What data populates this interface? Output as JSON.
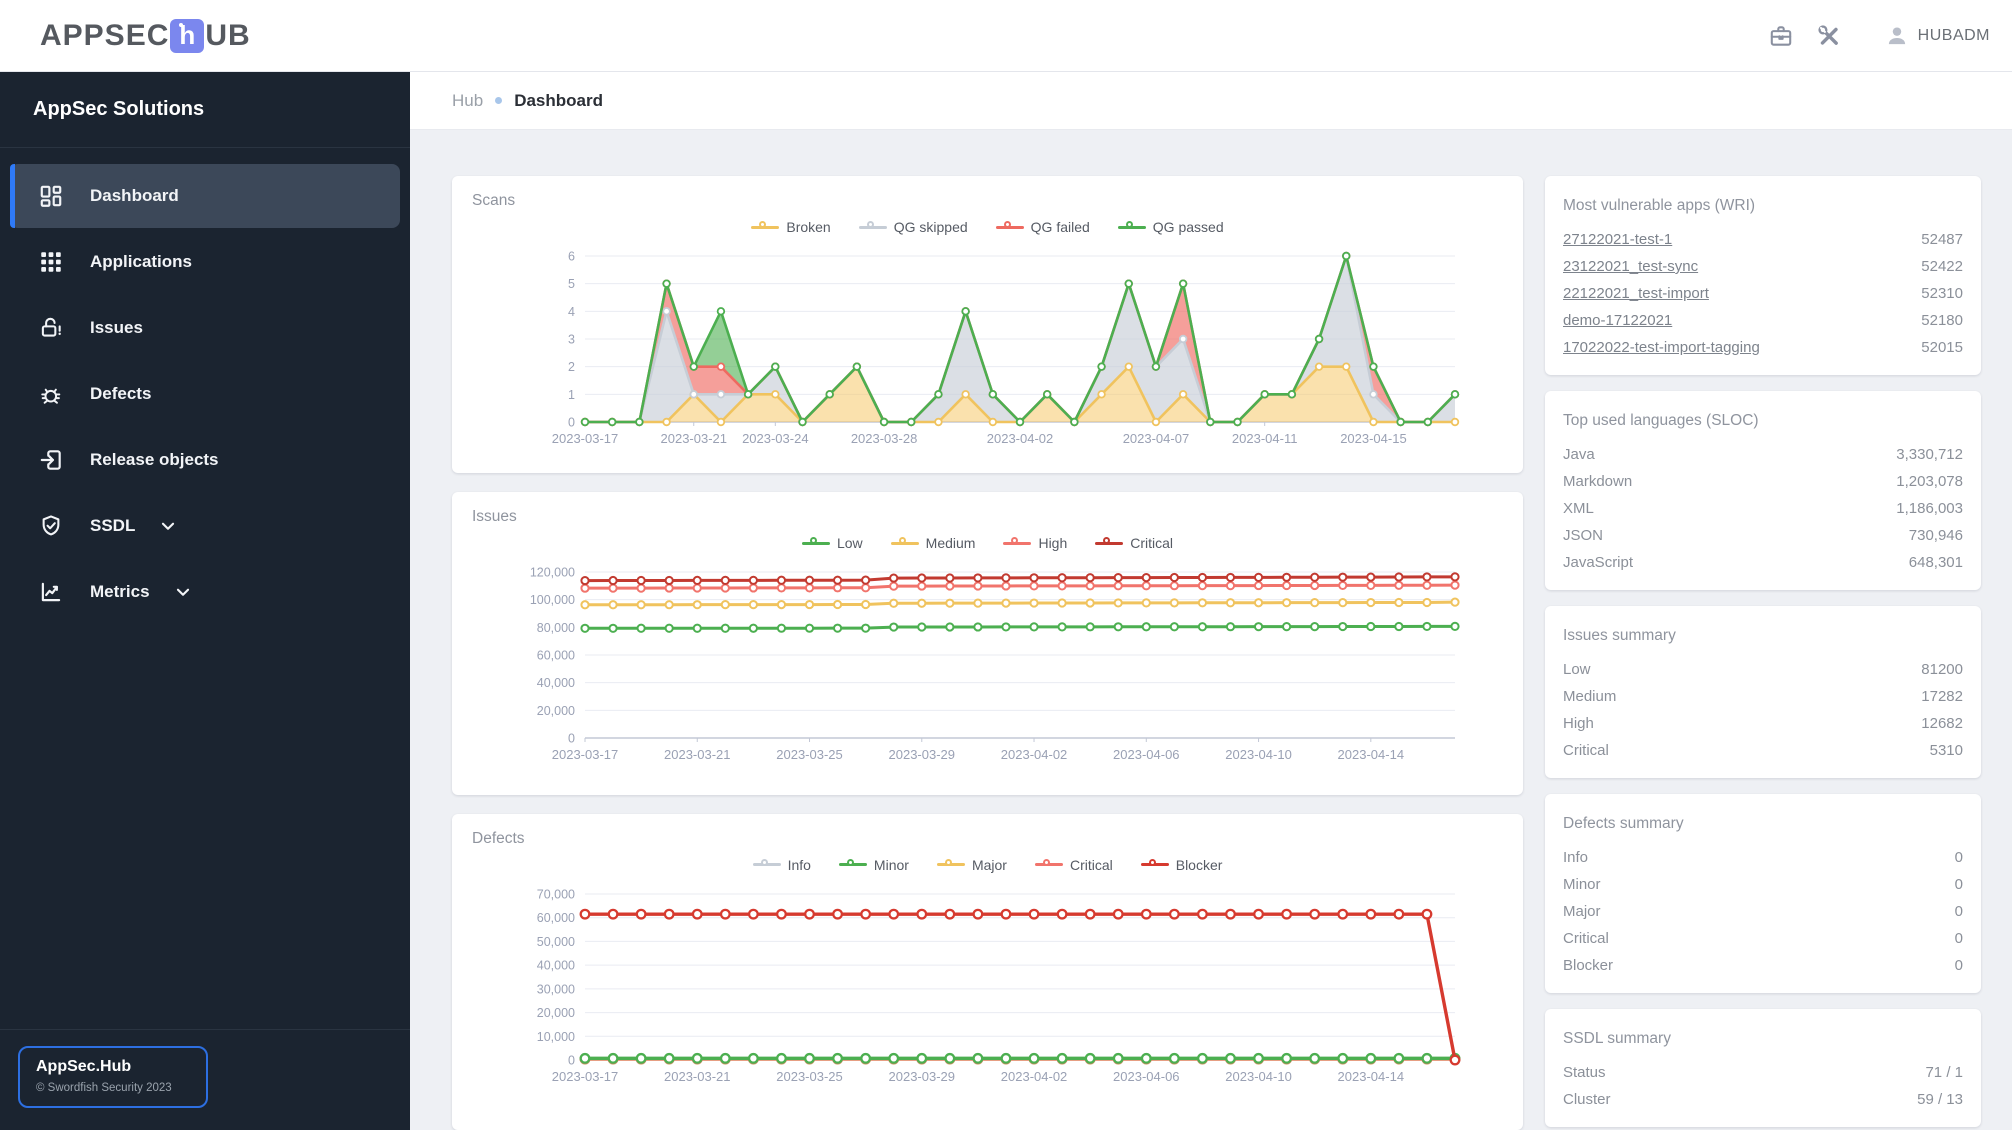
{
  "topbar": {
    "logo_pre": "APPSEC",
    "logo_mid": "h",
    "logo_post": "UB",
    "user_name": "HUBADM",
    "icons": [
      "briefcase-icon",
      "tools-icon",
      "person-icon"
    ]
  },
  "breadcrumb": {
    "root": "Hub",
    "current": "Dashboard"
  },
  "sidebar": {
    "title": "AppSec Solutions",
    "items": [
      {
        "label": "Dashboard",
        "icon": "dashboard",
        "active": true,
        "chevron": false
      },
      {
        "label": "Applications",
        "icon": "applications",
        "active": false,
        "chevron": false
      },
      {
        "label": "Issues",
        "icon": "lock-alert",
        "active": false,
        "chevron": false
      },
      {
        "label": "Defects",
        "icon": "bug",
        "active": false,
        "chevron": false
      },
      {
        "label": "Release objects",
        "icon": "exit-to-app",
        "active": false,
        "chevron": false
      },
      {
        "label": "SSDL",
        "icon": "shield-check",
        "active": false,
        "chevron": true
      },
      {
        "label": "Metrics",
        "icon": "chart-line",
        "active": false,
        "chevron": true
      }
    ],
    "footer_title": "AppSec.Hub",
    "footer_copyright": "© Swordfish Security 2023"
  },
  "chart_data": [
    {
      "type": "area",
      "stacked": true,
      "title": "Scans",
      "ylim": [
        0,
        6
      ],
      "y_step": 1,
      "y_comma": false,
      "line_width": 2.6,
      "marker_r": 3.3,
      "marker_stroke": 1.8,
      "grid": true,
      "legend_position": "top",
      "categories": [
        "2023-03-17",
        "2023-03-18",
        "2023-03-19",
        "2023-03-20",
        "2023-03-21",
        "2023-03-22",
        "2023-03-23",
        "2023-03-24",
        "2023-03-25",
        "2023-03-26",
        "2023-03-27",
        "2023-03-28",
        "2023-03-29",
        "2023-03-30",
        "2023-03-31",
        "2023-04-01",
        "2023-04-02",
        "2023-04-03",
        "2023-04-04",
        "2023-04-05",
        "2023-04-06",
        "2023-04-07",
        "2023-04-08",
        "2023-04-09",
        "2023-04-10",
        "2023-04-11",
        "2023-04-12",
        "2023-04-13",
        "2023-04-14",
        "2023-04-15",
        "2023-04-16",
        "2023-04-17",
        "2023-04-18"
      ],
      "tick_indices": [
        0,
        4,
        7,
        11,
        16,
        21,
        25,
        29
      ],
      "series": [
        {
          "name": "Broken",
          "color": "#f0c35e",
          "fill": "rgba(246,201,105,0.55)",
          "values": [
            0,
            0,
            0,
            0,
            1,
            0,
            1,
            1,
            0,
            1,
            2,
            0,
            0,
            0,
            1,
            0,
            0,
            1,
            0,
            1,
            2,
            0,
            1,
            0,
            0,
            1,
            1,
            2,
            2,
            0,
            0,
            0,
            0
          ]
        },
        {
          "name": "QG skipped",
          "color": "#c6cdd6",
          "fill": "rgba(199,206,215,0.65)",
          "values": [
            0,
            0,
            0,
            4,
            0,
            1,
            0,
            1,
            0,
            0,
            0,
            0,
            0,
            1,
            3,
            1,
            0,
            0,
            0,
            1,
            3,
            2,
            2,
            0,
            0,
            0,
            0,
            1,
            4,
            1,
            0,
            0,
            1
          ]
        },
        {
          "name": "QG failed",
          "color": "#ee6a60",
          "fill": "rgba(240,108,100,0.65)",
          "values": [
            0,
            0,
            0,
            1,
            1,
            1,
            0,
            0,
            0,
            0,
            0,
            0,
            0,
            0,
            0,
            0,
            0,
            0,
            0,
            0,
            0,
            0,
            2,
            0,
            0,
            0,
            0,
            0,
            0,
            1,
            0,
            0,
            0
          ]
        },
        {
          "name": "QG passed",
          "color": "#4caf50",
          "fill": "rgba(76,175,80,0.60)",
          "values": [
            0,
            0,
            0,
            0,
            0,
            2,
            0,
            0,
            0,
            0,
            0,
            0,
            0,
            0,
            0,
            0,
            0,
            0,
            0,
            0,
            0,
            0,
            0,
            0,
            0,
            0,
            0,
            0,
            0,
            0,
            0,
            0,
            0
          ]
        }
      ]
    },
    {
      "type": "line",
      "stacked": false,
      "title": "Issues",
      "ylim": [
        0,
        120000
      ],
      "y_step": 20000,
      "y_comma": true,
      "line_width": 3,
      "marker_r": 3.6,
      "marker_stroke": 2,
      "grid": true,
      "legend_position": "top",
      "categories": [
        "2023-03-17",
        "2023-03-18",
        "2023-03-19",
        "2023-03-20",
        "2023-03-21",
        "2023-03-22",
        "2023-03-23",
        "2023-03-24",
        "2023-03-25",
        "2023-03-26",
        "2023-03-27",
        "2023-03-28",
        "2023-03-29",
        "2023-03-30",
        "2023-03-31",
        "2023-04-01",
        "2023-04-02",
        "2023-04-03",
        "2023-04-04",
        "2023-04-05",
        "2023-04-06",
        "2023-04-07",
        "2023-04-08",
        "2023-04-09",
        "2023-04-10",
        "2023-04-11",
        "2023-04-12",
        "2023-04-13",
        "2023-04-14",
        "2023-04-15",
        "2023-04-16",
        "2023-04-17"
      ],
      "tick_indices": [
        0,
        4,
        8,
        12,
        16,
        20,
        24,
        28
      ],
      "series": [
        {
          "name": "Low",
          "color": "#4caf50",
          "fill": null,
          "values": [
            79300,
            79310,
            79320,
            79330,
            79340,
            79350,
            79360,
            79370,
            79380,
            79390,
            79400,
            80200,
            80230,
            80260,
            80280,
            80300,
            80320,
            80340,
            80360,
            80380,
            80400,
            80420,
            80440,
            80460,
            80480,
            80500,
            80530,
            80560,
            80590,
            80620,
            80650,
            80700
          ]
        },
        {
          "name": "Medium",
          "color": "#f0c35e",
          "fill": null,
          "values": [
            96300,
            96320,
            96340,
            96360,
            96380,
            96400,
            96420,
            96440,
            96460,
            96480,
            96500,
            97400,
            97430,
            97460,
            97490,
            97520,
            97550,
            97580,
            97610,
            97640,
            97670,
            97700,
            97730,
            97760,
            97790,
            97820,
            97850,
            97880,
            97910,
            97940,
            97970,
            98200
          ]
        },
        {
          "name": "High",
          "color": "#f1746c",
          "fill": null,
          "values": [
            108300,
            108330,
            108360,
            108390,
            108420,
            108450,
            108480,
            108510,
            108540,
            108570,
            108600,
            109800,
            109830,
            109860,
            109890,
            109920,
            109950,
            109980,
            110010,
            110040,
            110070,
            110100,
            110130,
            110160,
            110190,
            110220,
            110260,
            110300,
            110340,
            110380,
            110420,
            110500
          ]
        },
        {
          "name": "Critical",
          "color": "#c23a30",
          "fill": null,
          "values": [
            113800,
            113830,
            113860,
            113890,
            113920,
            113950,
            113980,
            114010,
            114040,
            114070,
            114100,
            115600,
            115640,
            115680,
            115720,
            115760,
            115800,
            115840,
            115880,
            115920,
            115960,
            116000,
            116040,
            116080,
            116120,
            116160,
            116200,
            116260,
            116320,
            116380,
            116440,
            116500
          ]
        }
      ]
    },
    {
      "type": "line",
      "stacked": false,
      "title": "Defects",
      "ylim": [
        0,
        70000
      ],
      "y_step": 10000,
      "y_comma": true,
      "line_width": 3.4,
      "marker_r": 4.3,
      "marker_stroke": 2.3,
      "grid": true,
      "legend_position": "top",
      "draw_order": [
        0,
        2,
        3,
        1,
        4
      ],
      "categories": [
        "2023-03-17",
        "2023-03-18",
        "2023-03-19",
        "2023-03-20",
        "2023-03-21",
        "2023-03-22",
        "2023-03-23",
        "2023-03-24",
        "2023-03-25",
        "2023-03-26",
        "2023-03-27",
        "2023-03-28",
        "2023-03-29",
        "2023-03-30",
        "2023-03-31",
        "2023-04-01",
        "2023-04-02",
        "2023-04-03",
        "2023-04-04",
        "2023-04-05",
        "2023-04-06",
        "2023-04-07",
        "2023-04-08",
        "2023-04-09",
        "2023-04-10",
        "2023-04-11",
        "2023-04-12",
        "2023-04-13",
        "2023-04-14",
        "2023-04-15",
        "2023-04-16",
        "2023-04-17"
      ],
      "tick_indices": [
        0,
        4,
        8,
        12,
        16,
        20,
        24,
        28
      ],
      "series": [
        {
          "name": "Info",
          "color": "#c6cdd6",
          "fill": null,
          "values": [
            300,
            300,
            300,
            300,
            300,
            300,
            300,
            300,
            300,
            300,
            300,
            300,
            300,
            300,
            300,
            300,
            300,
            300,
            300,
            300,
            300,
            300,
            300,
            300,
            300,
            300,
            300,
            300,
            300,
            300,
            300,
            300
          ]
        },
        {
          "name": "Minor",
          "color": "#4caf50",
          "fill": null,
          "values": [
            700,
            700,
            700,
            700,
            700,
            700,
            700,
            700,
            700,
            700,
            700,
            700,
            700,
            700,
            700,
            700,
            700,
            700,
            700,
            700,
            700,
            700,
            700,
            700,
            700,
            700,
            700,
            700,
            700,
            700,
            700,
            700
          ]
        },
        {
          "name": "Major",
          "color": "#f0c35e",
          "fill": null,
          "values": [
            400,
            400,
            400,
            400,
            400,
            400,
            400,
            400,
            400,
            400,
            400,
            400,
            400,
            400,
            400,
            400,
            400,
            400,
            400,
            400,
            400,
            400,
            400,
            400,
            400,
            400,
            400,
            400,
            400,
            400,
            400,
            400
          ]
        },
        {
          "name": "Critical",
          "color": "#f1746c",
          "fill": null,
          "values": [
            500,
            500,
            500,
            500,
            500,
            500,
            500,
            500,
            500,
            500,
            500,
            500,
            500,
            500,
            500,
            500,
            500,
            500,
            500,
            500,
            500,
            500,
            500,
            500,
            500,
            500,
            500,
            500,
            500,
            500,
            500,
            500
          ]
        },
        {
          "name": "Blocker",
          "color": "#d63a2f",
          "fill": null,
          "values": [
            61500,
            61500,
            61500,
            61500,
            61500,
            61500,
            61500,
            61500,
            61500,
            61500,
            61500,
            61500,
            61500,
            61500,
            61500,
            61500,
            61500,
            61500,
            61500,
            61500,
            61500,
            61500,
            61500,
            61500,
            61500,
            61500,
            61500,
            61500,
            61500,
            61500,
            61500,
            0
          ]
        }
      ]
    }
  ],
  "right_panels": [
    {
      "title": "Most vulnerable apps (WRI)",
      "rows": [
        {
          "label": "27122021-test-1",
          "value": "52487",
          "link": true
        },
        {
          "label": "23122021_test-sync",
          "value": "52422",
          "link": true
        },
        {
          "label": "22122021_test-import",
          "value": "52310",
          "link": true
        },
        {
          "label": "demo-17122021",
          "value": "52180",
          "link": true
        },
        {
          "label": "17022022-test-import-tagging",
          "value": "52015",
          "link": true
        }
      ]
    },
    {
      "title": "Top used languages (SLOC)",
      "rows": [
        {
          "label": "Java",
          "value": "3,330,712",
          "link": false
        },
        {
          "label": "Markdown",
          "value": "1,203,078",
          "link": false
        },
        {
          "label": "XML",
          "value": "1,186,003",
          "link": false
        },
        {
          "label": "JSON",
          "value": "730,946",
          "link": false
        },
        {
          "label": "JavaScript",
          "value": "648,301",
          "link": false
        }
      ]
    },
    {
      "title": "Issues summary",
      "rows": [
        {
          "label": "Low",
          "value": "81200",
          "link": false
        },
        {
          "label": "Medium",
          "value": "17282",
          "link": false
        },
        {
          "label": "High",
          "value": "12682",
          "link": false
        },
        {
          "label": "Critical",
          "value": "5310",
          "link": false
        }
      ]
    },
    {
      "title": "Defects summary",
      "rows": [
        {
          "label": "Info",
          "value": "0",
          "link": false
        },
        {
          "label": "Minor",
          "value": "0",
          "link": false
        },
        {
          "label": "Major",
          "value": "0",
          "link": false
        },
        {
          "label": "Critical",
          "value": "0",
          "link": false
        },
        {
          "label": "Blocker",
          "value": "0",
          "link": false
        }
      ]
    },
    {
      "title": "SSDL summary",
      "rows": [
        {
          "label": "Status",
          "value": "71 / 1",
          "link": false
        },
        {
          "label": "Cluster",
          "value": "59 / 13",
          "link": false
        }
      ]
    }
  ]
}
